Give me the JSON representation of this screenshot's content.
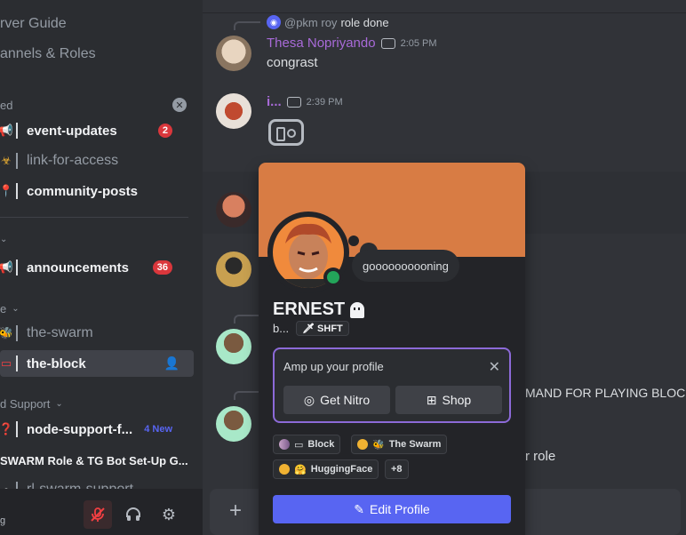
{
  "sidebar": {
    "server_guide": "rver Guide",
    "channels_roles": "annels & Roles",
    "category_1": "ed",
    "category_2": "",
    "category_3": "e",
    "category_4": "d Support",
    "channels": [
      {
        "name": "event-updates",
        "badge": "2"
      },
      {
        "name": "link-for-access"
      },
      {
        "name": "community-posts"
      },
      {
        "name": "announcements",
        "badge": "36"
      },
      {
        "name": "the-swarm"
      },
      {
        "name": "the-block"
      },
      {
        "name": "node-support-f...",
        "new": "4 New"
      },
      {
        "name": "SWARM Role & TG Bot Set-Up G..."
      },
      {
        "name": "rl-swarm-support"
      }
    ],
    "user_tail": "g"
  },
  "chat": {
    "reply1": {
      "mention": "@pkm roy",
      "text": "role done"
    },
    "msg1": {
      "name": "Thesa Nopriyando",
      "time": "2:05 PM",
      "body": "congrast"
    },
    "msg2": {
      "name": "i...",
      "time": "2:39 PM"
    },
    "cut1": "MAND FOR PLAYING BLOCKAS",
    "cut2": "r role"
  },
  "profile": {
    "status": "goooooooooning",
    "name": "ERNEST",
    "sub": "b...",
    "clan_tag": "SHFT",
    "nitro_title": "Amp up your profile",
    "get_nitro": "Get Nitro",
    "shop": "Shop",
    "roles": [
      {
        "label": "Block",
        "color": "#c8a2c8"
      },
      {
        "label": "The Swarm",
        "color": "#f0b232"
      },
      {
        "label": "HuggingFace",
        "color": "#f0b232"
      }
    ],
    "more": "+8",
    "edit": "Edit Profile"
  },
  "colors": {
    "accent": "#5865f2",
    "banner": "#d87c44",
    "online": "#23a55a",
    "danger": "#da373c",
    "msg1_name": "#a86ad8"
  }
}
